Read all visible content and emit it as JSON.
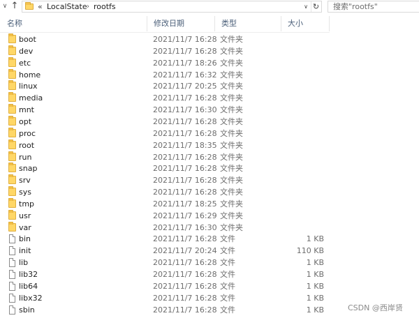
{
  "address_bar": {
    "overflow": "«",
    "path": [
      "LocalState",
      "rootfs"
    ],
    "separator": "›",
    "dropdown": "∨",
    "refresh": "↻"
  },
  "search": {
    "placeholder": "搜索\"rootfs\""
  },
  "columns": {
    "name": "名称",
    "date": "修改日期",
    "type": "类型",
    "size": "大小"
  },
  "files": [
    {
      "name": "boot",
      "date": "2021/11/7 16:28",
      "type": "文件夹",
      "size": "",
      "icon": "folder-icon"
    },
    {
      "name": "dev",
      "date": "2021/11/7 16:28",
      "type": "文件夹",
      "size": "",
      "icon": "folder-icon"
    },
    {
      "name": "etc",
      "date": "2021/11/7 18:26",
      "type": "文件夹",
      "size": "",
      "icon": "folder-icon"
    },
    {
      "name": "home",
      "date": "2021/11/7 16:32",
      "type": "文件夹",
      "size": "",
      "icon": "folder-icon"
    },
    {
      "name": "linux",
      "date": "2021/11/7 20:25",
      "type": "文件夹",
      "size": "",
      "icon": "folder-icon"
    },
    {
      "name": "media",
      "date": "2021/11/7 16:28",
      "type": "文件夹",
      "size": "",
      "icon": "folder-icon"
    },
    {
      "name": "mnt",
      "date": "2021/11/7 16:30",
      "type": "文件夹",
      "size": "",
      "icon": "folder-icon"
    },
    {
      "name": "opt",
      "date": "2021/11/7 16:28",
      "type": "文件夹",
      "size": "",
      "icon": "folder-icon"
    },
    {
      "name": "proc",
      "date": "2021/11/7 16:28",
      "type": "文件夹",
      "size": "",
      "icon": "folder-icon"
    },
    {
      "name": "root",
      "date": "2021/11/7 18:35",
      "type": "文件夹",
      "size": "",
      "icon": "folder-icon"
    },
    {
      "name": "run",
      "date": "2021/11/7 16:28",
      "type": "文件夹",
      "size": "",
      "icon": "folder-icon"
    },
    {
      "name": "snap",
      "date": "2021/11/7 16:28",
      "type": "文件夹",
      "size": "",
      "icon": "folder-icon"
    },
    {
      "name": "srv",
      "date": "2021/11/7 16:28",
      "type": "文件夹",
      "size": "",
      "icon": "folder-icon"
    },
    {
      "name": "sys",
      "date": "2021/11/7 16:28",
      "type": "文件夹",
      "size": "",
      "icon": "folder-icon"
    },
    {
      "name": "tmp",
      "date": "2021/11/7 18:25",
      "type": "文件夹",
      "size": "",
      "icon": "folder-icon"
    },
    {
      "name": "usr",
      "date": "2021/11/7 16:29",
      "type": "文件夹",
      "size": "",
      "icon": "folder-icon"
    },
    {
      "name": "var",
      "date": "2021/11/7 16:30",
      "type": "文件夹",
      "size": "",
      "icon": "folder-icon"
    },
    {
      "name": "bin",
      "date": "2021/11/7 16:28",
      "type": "文件",
      "size": "1 KB",
      "icon": "file-icon"
    },
    {
      "name": "init",
      "date": "2021/11/7 20:24",
      "type": "文件",
      "size": "110 KB",
      "icon": "file-icon"
    },
    {
      "name": "lib",
      "date": "2021/11/7 16:28",
      "type": "文件",
      "size": "1 KB",
      "icon": "file-icon"
    },
    {
      "name": "lib32",
      "date": "2021/11/7 16:28",
      "type": "文件",
      "size": "1 KB",
      "icon": "file-icon"
    },
    {
      "name": "lib64",
      "date": "2021/11/7 16:28",
      "type": "文件",
      "size": "1 KB",
      "icon": "file-icon"
    },
    {
      "name": "libx32",
      "date": "2021/11/7 16:28",
      "type": "文件",
      "size": "1 KB",
      "icon": "file-icon"
    },
    {
      "name": "sbin",
      "date": "2021/11/7 16:28",
      "type": "文件",
      "size": "1 KB",
      "icon": "file-icon"
    }
  ],
  "watermark": "CSDN @西岸贤",
  "colors": {
    "folder": "#ffd767",
    "header_text": "#4c607a",
    "detail_text": "#6d6d6d"
  }
}
